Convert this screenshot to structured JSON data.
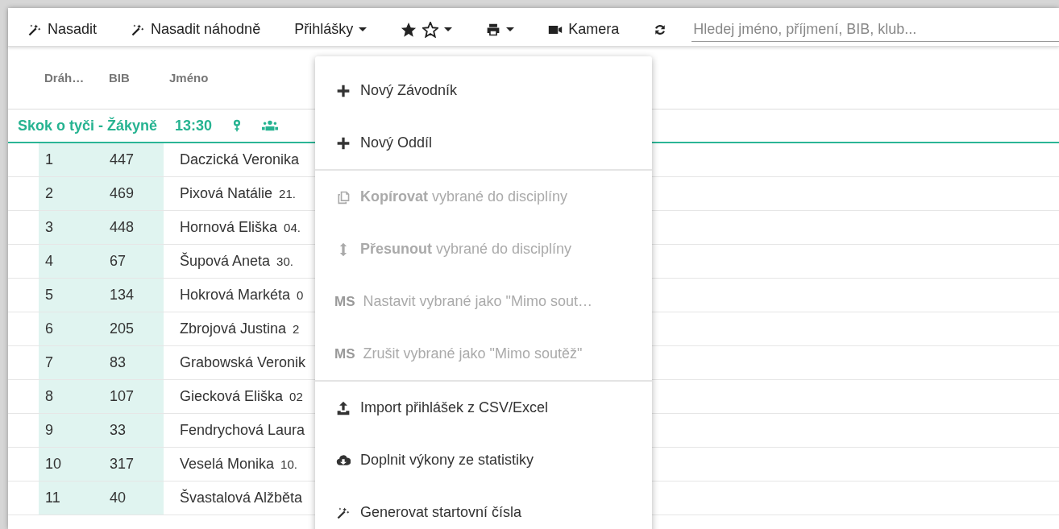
{
  "toolbar": {
    "items": [
      {
        "kind": "button",
        "label": "Nasadit"
      },
      {
        "kind": "button",
        "label": "Nasadit náhodně"
      },
      {
        "kind": "dropdown",
        "label": "Přihlášky"
      },
      {
        "kind": "dropdown"
      },
      {
        "kind": "dropdown"
      },
      {
        "kind": "button",
        "label": "Kamera"
      },
      {
        "kind": "button"
      }
    ],
    "search": {
      "placeholder": "Hledej jméno, příjmení, BIB, klub..."
    }
  },
  "table": {
    "columns": [
      "Dráh…",
      "BIB",
      "Jméno"
    ],
    "group": {
      "title": "Skok o tyči - Žákyně",
      "time": "13:30"
    },
    "rows": [
      {
        "lane": "1",
        "bib": "447",
        "name": "Daczická Veronika",
        "date": ""
      },
      {
        "lane": "2",
        "bib": "469",
        "name": "Pixová Natálie",
        "date": "21."
      },
      {
        "lane": "3",
        "bib": "448",
        "name": "Hornová Eliška",
        "date": "04."
      },
      {
        "lane": "4",
        "bib": "67",
        "name": "Šupová Aneta",
        "date": "30."
      },
      {
        "lane": "5",
        "bib": "134",
        "name": "Hokrová Markéta",
        "date": "0"
      },
      {
        "lane": "6",
        "bib": "205",
        "name": "Zbrojová Justina",
        "date": "2"
      },
      {
        "lane": "7",
        "bib": "83",
        "name": "Grabowská Veronik",
        "date": ""
      },
      {
        "lane": "8",
        "bib": "107",
        "name": "Giecková Eliška",
        "date": "02"
      },
      {
        "lane": "9",
        "bib": "33",
        "name": "Fendrychová Laura",
        "date": ""
      },
      {
        "lane": "10",
        "bib": "317",
        "name": "Veselá Monika",
        "date": "10."
      },
      {
        "lane": "11",
        "bib": "40",
        "name": "Švastalová Alžběta",
        "date": ""
      }
    ]
  },
  "menu": {
    "items": [
      {
        "kind": "item",
        "label": "Nový Závodník",
        "disabled": false
      },
      {
        "kind": "item",
        "label": "Nový Oddíl",
        "disabled": false
      },
      {
        "kind": "separator"
      },
      {
        "kind": "item",
        "label": "**Kopírovat** vybrané do disciplíny",
        "disabled": true
      },
      {
        "kind": "item",
        "label": "**Přesunout** vybrané do disciplíny",
        "disabled": true
      },
      {
        "kind": "item",
        "badge": "MS",
        "label": "Nastavit vybrané jako \"Mimo sout…",
        "disabled": true
      },
      {
        "kind": "item",
        "badge": "MS",
        "label": "Zrušit vybrané jako \"Mimo soutěž\"",
        "disabled": true
      },
      {
        "kind": "separator"
      },
      {
        "kind": "item",
        "label": "Import přihlášek z CSV/Excel",
        "disabled": false
      },
      {
        "kind": "item",
        "label": "Doplnit výkony ze statistiky",
        "disabled": false
      },
      {
        "kind": "item",
        "label": "Generovat startovní čísla",
        "disabled": false
      }
    ]
  }
}
